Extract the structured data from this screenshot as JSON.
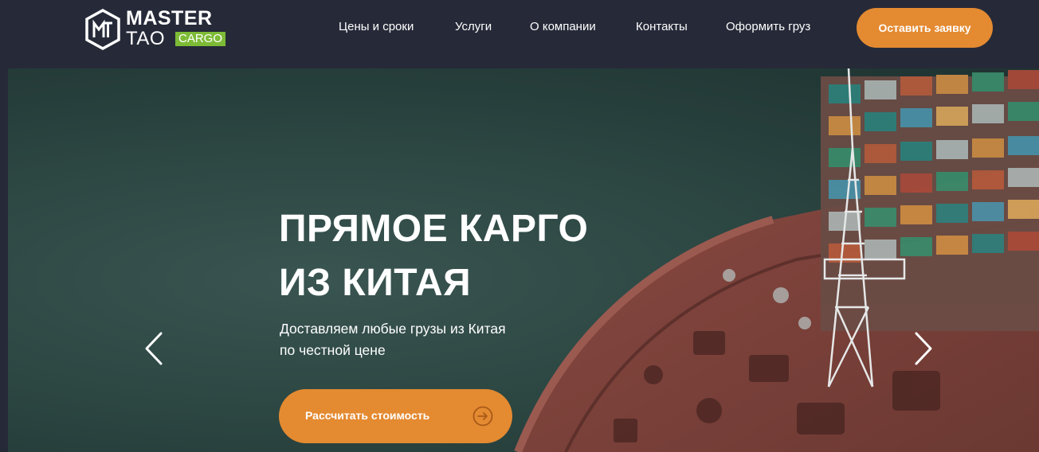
{
  "brand": {
    "name_line1": "MASTER",
    "name_line2": "TAO",
    "tag": "CARGO",
    "tag_color": "#7dbb36"
  },
  "nav": {
    "items": [
      "Цены и сроки",
      "Услуги",
      "О компании",
      "Контакты",
      "Оформить груз"
    ]
  },
  "header": {
    "cta_label": "Оставить заявку",
    "accent_color": "#e48a31",
    "background_color": "#262a38"
  },
  "hero": {
    "title_line1": "ПРЯМОЕ КАРГО",
    "title_line2": "ИЗ КИТАЯ",
    "subtitle_line1": "Доставляем любые грузы из Китая",
    "subtitle_line2": "по честной цене",
    "cta_label": "Рассчитать стоимость",
    "cta_icon": "arrow-right-circle-icon",
    "prev_icon": "chevron-left-icon",
    "next_icon": "chevron-right-icon"
  }
}
